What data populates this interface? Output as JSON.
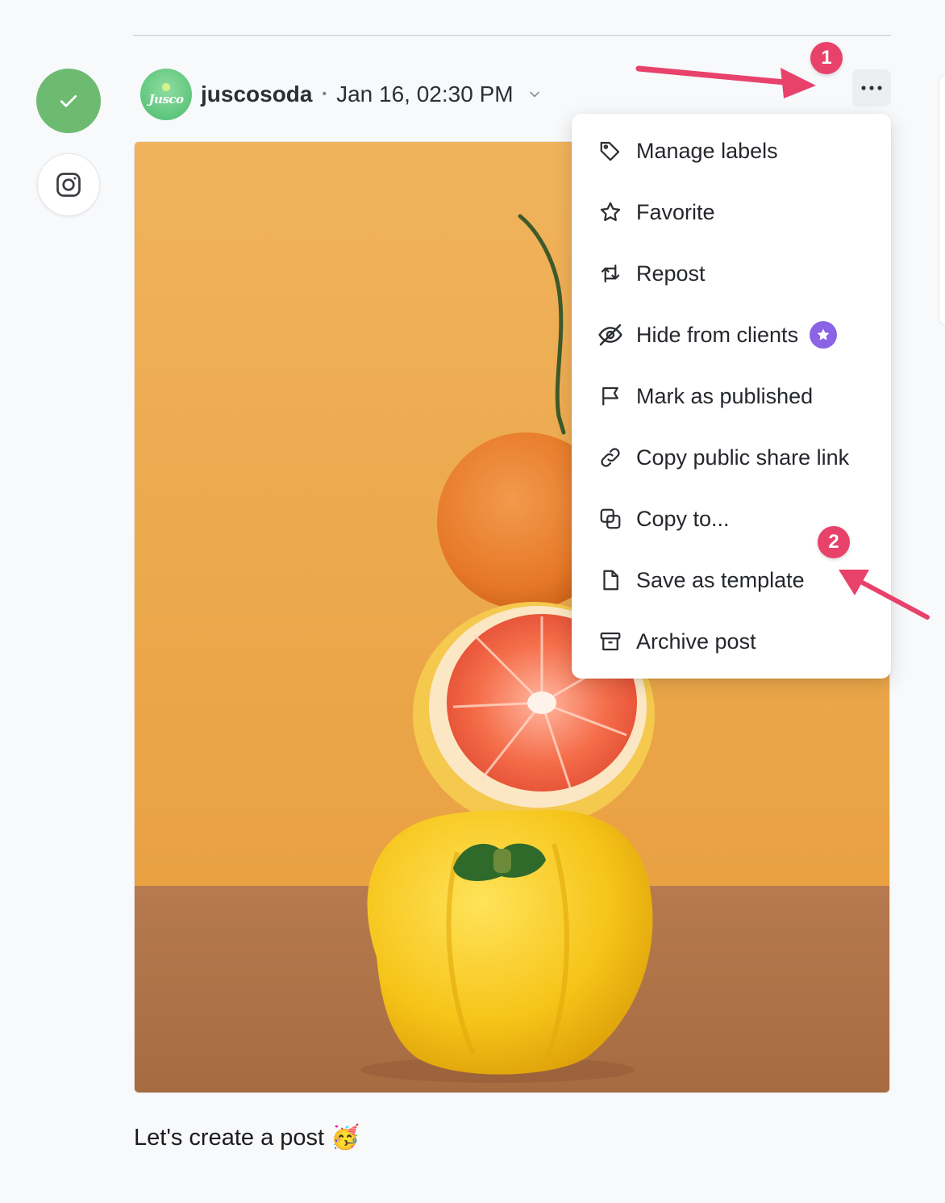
{
  "post": {
    "username": "juscosoda",
    "separator": "•",
    "datetime": "Jan 16, 02:30 PM",
    "avatar_text": "Jusco",
    "caption": "Let's create a post",
    "caption_emoji": "🥳"
  },
  "menu": {
    "more_label": "•••",
    "items": [
      {
        "label": "Manage labels",
        "icon": "tag-icon"
      },
      {
        "label": "Favorite",
        "icon": "star-icon"
      },
      {
        "label": "Repost",
        "icon": "repost-icon"
      },
      {
        "label": "Hide from clients",
        "icon": "eye-off-icon",
        "badge": "pro-star-badge"
      },
      {
        "label": "Mark as published",
        "icon": "flag-icon"
      },
      {
        "label": "Copy public share link",
        "icon": "link-icon"
      },
      {
        "label": "Copy to...",
        "icon": "copy-icon"
      },
      {
        "label": "Save as template",
        "icon": "file-icon"
      },
      {
        "label": "Archive post",
        "icon": "archive-icon"
      }
    ]
  },
  "annotations": {
    "step1": "1",
    "step2": "2"
  },
  "colors": {
    "status_green": "#6cbb71",
    "annotation_pink": "#e8426b",
    "pro_badge_purple": "#8a63e6",
    "image_background": "#eeaa4a"
  }
}
